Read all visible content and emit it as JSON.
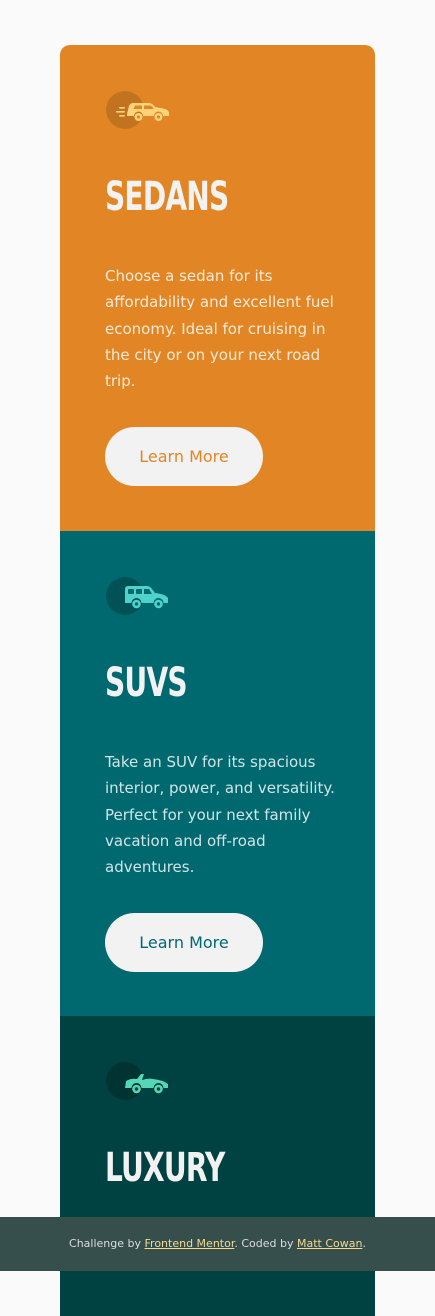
{
  "cards": [
    {
      "title": "Sedans",
      "text": "Choose a sedan for its affordability and excellent fuel economy. Ideal for cruising in the city or on your next road trip.",
      "button_label": "Learn More",
      "icon": "sedan-car-icon",
      "color": "#e28625"
    },
    {
      "title": "SUVs",
      "text": "Take an SUV for its spacious interior, power, and versatility. Perfect for your next family vacation and off-road adventures.",
      "button_label": "Learn More",
      "icon": "suv-car-icon",
      "color": "#006970"
    },
    {
      "title": "Luxury",
      "icon": "luxury-car-icon",
      "color": "#004241"
    }
  ],
  "attribution": {
    "prefix": "Challenge by ",
    "challenge_link": "Frontend Mentor",
    "middle": ". Coded by ",
    "author_link": "Matt Cowan",
    "suffix": "."
  },
  "colors": {
    "page_background": "#fafafa",
    "button_background": "#f2f2f2",
    "footer_background": "#364e4c",
    "link": "#f4d98f"
  }
}
